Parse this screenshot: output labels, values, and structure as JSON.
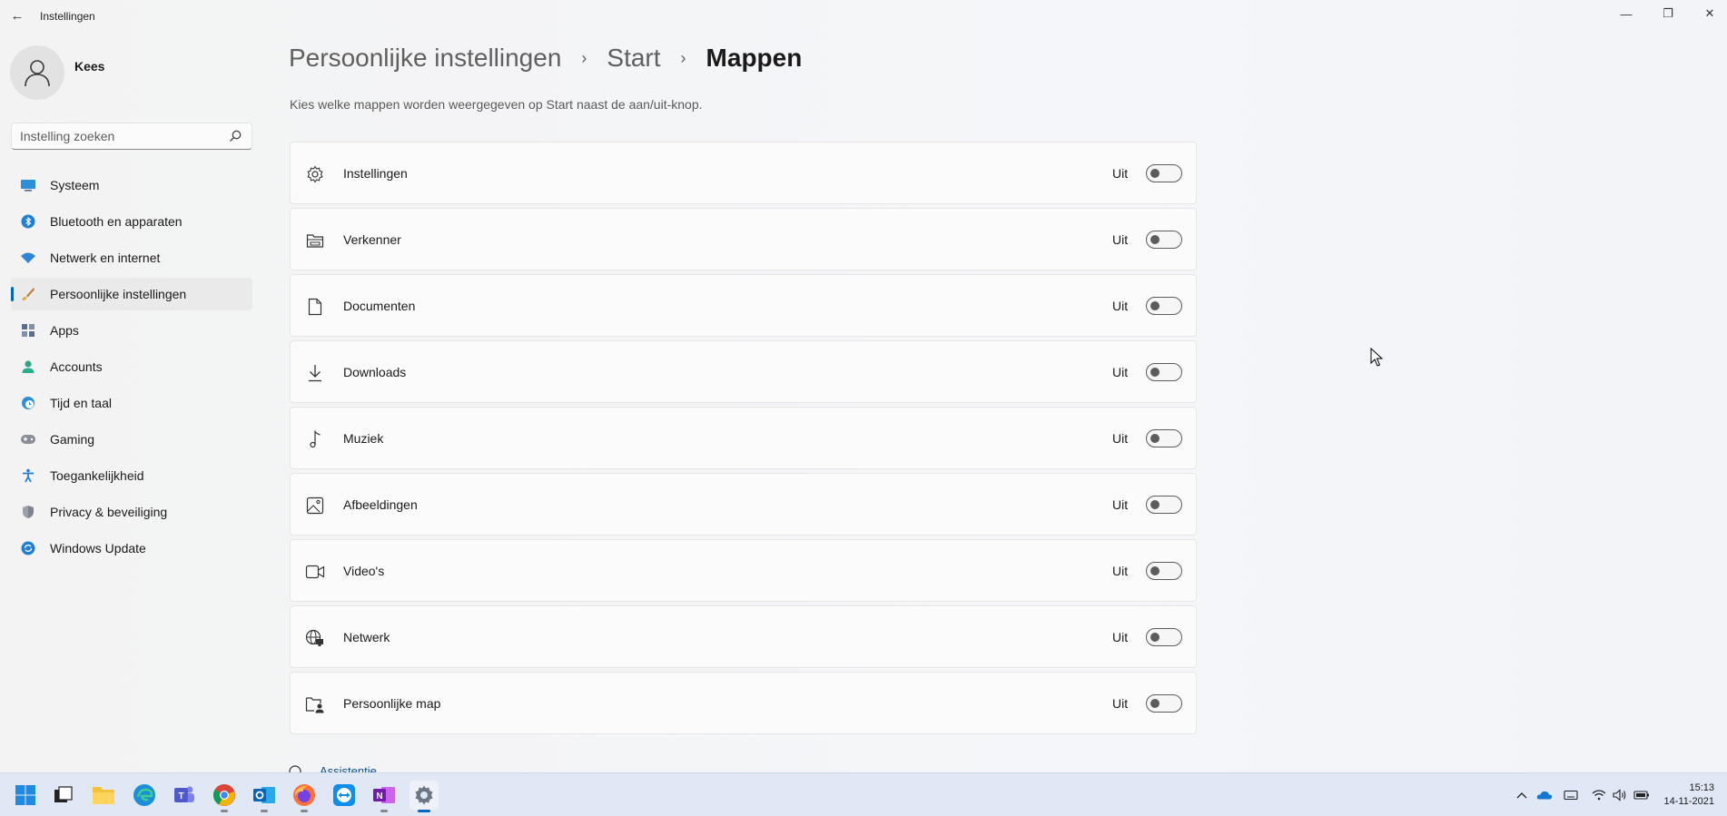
{
  "window": {
    "title": "Instellingen",
    "back_glyph": "←",
    "minimize_glyph": "—",
    "maximize_glyph": "❐",
    "close_glyph": "✕"
  },
  "profile": {
    "name": "Kees"
  },
  "search": {
    "placeholder": "Instelling zoeken",
    "value": ""
  },
  "nav": {
    "items": [
      {
        "label": "Systeem",
        "icon": "monitor-icon"
      },
      {
        "label": "Bluetooth en apparaten",
        "icon": "bluetooth-icon"
      },
      {
        "label": "Netwerk en internet",
        "icon": "wifi-icon"
      },
      {
        "label": "Persoonlijke instellingen",
        "icon": "brush-icon",
        "active": true
      },
      {
        "label": "Apps",
        "icon": "apps-icon"
      },
      {
        "label": "Accounts",
        "icon": "person-icon"
      },
      {
        "label": "Tijd en taal",
        "icon": "clock-globe-icon"
      },
      {
        "label": "Gaming",
        "icon": "controller-icon"
      },
      {
        "label": "Toegankelijkheid",
        "icon": "accessibility-icon"
      },
      {
        "label": "Privacy & beveiliging",
        "icon": "shield-icon"
      },
      {
        "label": "Windows Update",
        "icon": "update-icon"
      }
    ]
  },
  "breadcrumb": {
    "items": [
      "Persoonlijke instellingen",
      "Start"
    ],
    "current": "Mappen",
    "separator": "›"
  },
  "description": "Kies welke mappen worden weergegeven op Start naast de aan/uit-knop.",
  "folders": [
    {
      "label": "Instellingen",
      "status": "Uit",
      "on": false,
      "icon": "gear-icon"
    },
    {
      "label": "Verkenner",
      "status": "Uit",
      "on": false,
      "icon": "file-explorer-icon"
    },
    {
      "label": "Documenten",
      "status": "Uit",
      "on": false,
      "icon": "document-icon"
    },
    {
      "label": "Downloads",
      "status": "Uit",
      "on": false,
      "icon": "download-icon"
    },
    {
      "label": "Muziek",
      "status": "Uit",
      "on": false,
      "icon": "music-icon"
    },
    {
      "label": "Afbeeldingen",
      "status": "Uit",
      "on": false,
      "icon": "image-icon"
    },
    {
      "label": "Video's",
      "status": "Uit",
      "on": false,
      "icon": "video-icon"
    },
    {
      "label": "Netwerk",
      "status": "Uit",
      "on": false,
      "icon": "network-globe-icon"
    },
    {
      "label": "Persoonlijke map",
      "status": "Uit",
      "on": false,
      "icon": "personal-folder-icon"
    }
  ],
  "partial_link": "Assistentie",
  "taskbar": {
    "apps": [
      {
        "name": "start-button",
        "icon": "windows-logo-icon"
      },
      {
        "name": "task-view",
        "icon": "task-view-icon"
      },
      {
        "name": "file-explorer",
        "icon": "folder-icon"
      },
      {
        "name": "edge",
        "icon": "edge-icon"
      },
      {
        "name": "teams",
        "icon": "teams-icon"
      },
      {
        "name": "chrome",
        "icon": "chrome-icon"
      },
      {
        "name": "outlook",
        "icon": "outlook-icon"
      },
      {
        "name": "firefox",
        "icon": "firefox-icon"
      },
      {
        "name": "teamviewer",
        "icon": "teamviewer-icon"
      },
      {
        "name": "onenote",
        "icon": "onenote-icon"
      },
      {
        "name": "settings",
        "icon": "settings-icon",
        "active": true
      }
    ],
    "time": "15:13",
    "date": "14-11-2021"
  },
  "colors": {
    "accent": "#0067c0",
    "taskbar": "#dfe8f4",
    "card": "#fbfbfb"
  }
}
